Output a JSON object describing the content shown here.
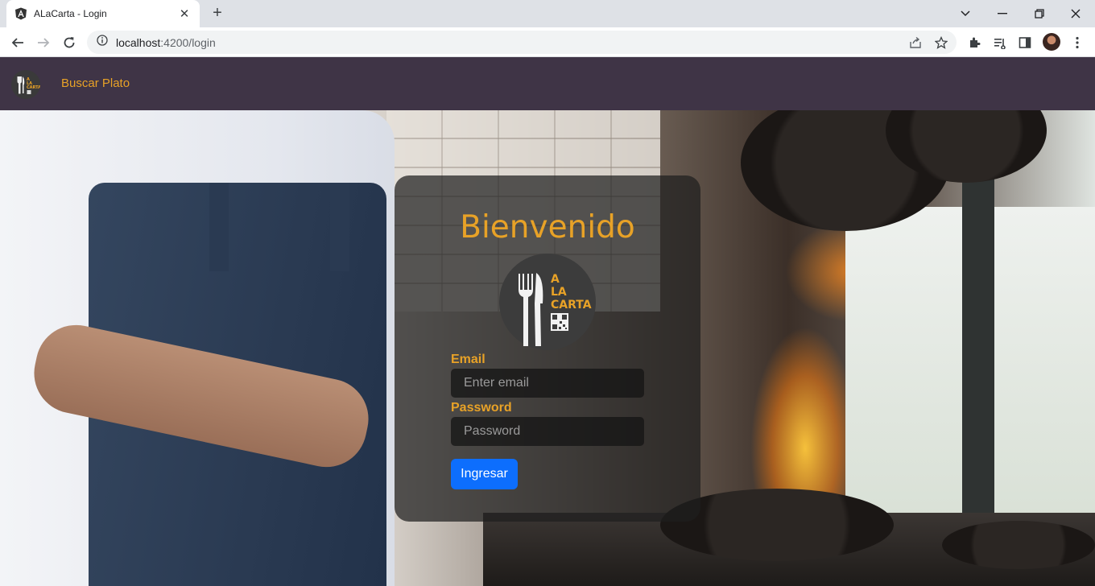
{
  "browser": {
    "tab_title": "ALaCarta - Login",
    "url_host": "localhost",
    "url_rest": ":4200/login"
  },
  "navbar": {
    "link_label": "Buscar Plato"
  },
  "login": {
    "title": "Bienvenido",
    "logo_line1": "A",
    "logo_line2": "LA",
    "logo_line3": "CARTA",
    "email_label": "Email",
    "email_placeholder": "Enter email",
    "email_value": "",
    "password_label": "Password",
    "password_placeholder": "Password",
    "password_value": "",
    "submit_label": "Ingresar"
  },
  "colors": {
    "accent": "#e8a227",
    "navbar": "#3f3446",
    "button": "#0d6efd"
  }
}
